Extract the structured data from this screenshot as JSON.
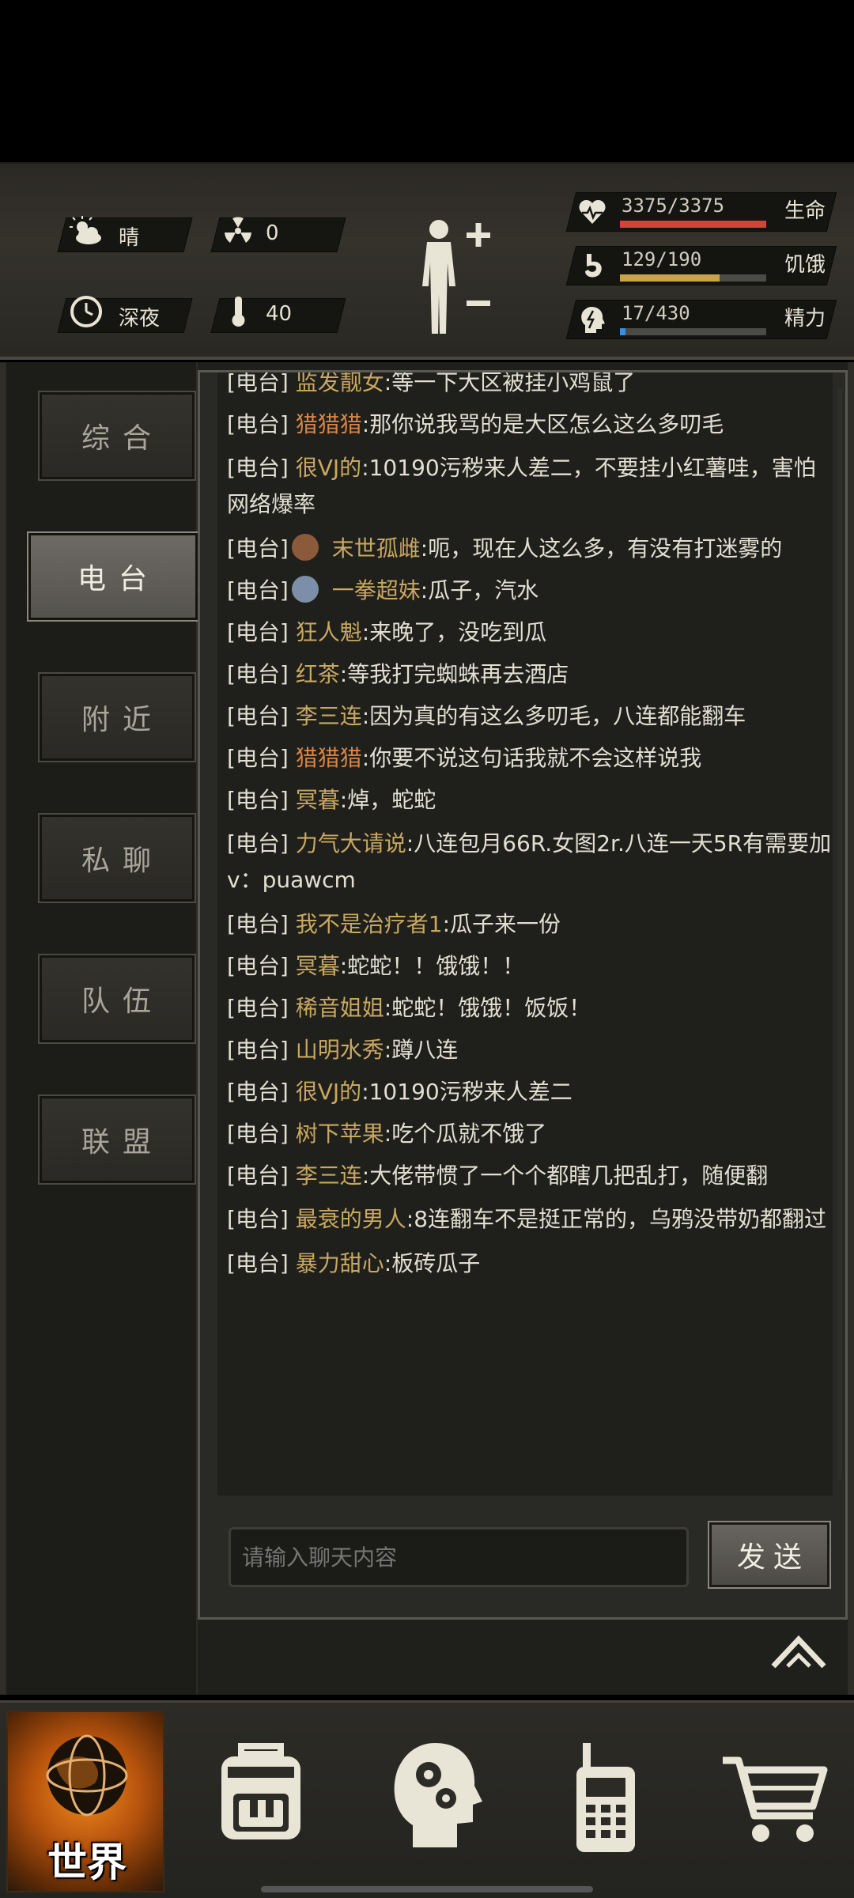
{
  "hud": {
    "weather": {
      "icon": "cloud-sun-icon",
      "label": "晴"
    },
    "radiation": {
      "icon": "radiation-icon",
      "value": "0"
    },
    "time": {
      "icon": "clock-icon",
      "label": "深夜"
    },
    "temperature": {
      "icon": "thermometer-icon",
      "value": "40"
    },
    "stats": [
      {
        "icon": "heart-pulse-icon",
        "text": "3375/3375",
        "label": "生命",
        "fill": 1.0,
        "color": "#d0443a"
      },
      {
        "icon": "stomach-icon",
        "text": "129/190",
        "label": "饥饿",
        "fill": 0.679,
        "color": "#c9a24a"
      },
      {
        "icon": "head-bolt-icon",
        "text": "17/430",
        "label": "精力",
        "fill": 0.04,
        "color": "#3b8ed8"
      }
    ]
  },
  "tabs": [
    {
      "label": "综合",
      "active": false
    },
    {
      "label": "电台",
      "active": true
    },
    {
      "label": "附近",
      "active": false
    },
    {
      "label": "私聊",
      "active": false
    },
    {
      "label": "队伍",
      "active": false
    },
    {
      "label": "联盟",
      "active": false
    }
  ],
  "chat": {
    "channel_tag": "[电台]",
    "messages": [
      {
        "name": "监发靓女",
        "text": ":等一下大区被挂小鸡鼠了",
        "style": "yellow"
      },
      {
        "name": "猎猎猎",
        "text": ":那你说我骂的是大区怎么这么多叨毛",
        "style": "orange"
      },
      {
        "name": "很VJ的",
        "text": ":10190污秽来人差二，不要挂小红薯哇，害怕网络爆率",
        "style": "yellow"
      },
      {
        "name": "末世孤雌",
        "text": ":呃，现在人这么多，有没有打迷雾的",
        "style": "yellow",
        "avatar": "#8a5a3a"
      },
      {
        "name": "一拳超妹",
        "text": ":瓜子，汽水",
        "style": "yellow",
        "avatar": "#7d8fa8"
      },
      {
        "name": "狂人魁",
        "text": ":来晚了，没吃到瓜",
        "style": "yellow"
      },
      {
        "name": "红茶",
        "text": ":等我打完蜘蛛再去酒店",
        "style": "yellow"
      },
      {
        "name": "李三连",
        "text": ":因为真的有这么多叨毛，八连都能翻车",
        "style": "yellow"
      },
      {
        "name": "猎猎猎",
        "text": ":你要不说这句话我就不会这样说我",
        "style": "orange"
      },
      {
        "name": "冥暮",
        "text": ":焯，蛇蛇",
        "style": "yellow"
      },
      {
        "name": "力气大请说",
        "text": ":八连包月66R.女图2r.八连一天5R有需要加v：puawcm",
        "style": "yellow"
      },
      {
        "name": "我不是治疗者1",
        "text": ":瓜子来一份",
        "style": "yellow"
      },
      {
        "name": "冥暮",
        "text": ":蛇蛇！！饿饿！！",
        "style": "yellow"
      },
      {
        "name": "稀音姐姐",
        "text": ":蛇蛇！饿饿！饭饭！",
        "style": "yellow"
      },
      {
        "name": "山明水秀",
        "text": ":蹲八连",
        "style": "yellow"
      },
      {
        "name": "很VJ的",
        "text": ":10190污秽来人差二",
        "style": "yellow"
      },
      {
        "name": "树下苹果",
        "text": ":吃个瓜就不饿了",
        "style": "yellow"
      },
      {
        "name": "李三连",
        "text": ":大佬带惯了一个个都瞎几把乱打，随便翻",
        "style": "yellow"
      },
      {
        "name": "最衰的男人",
        "text": ":8连翻车不是挺正常的，乌鸦没带奶都翻过",
        "style": "yellow"
      },
      {
        "name": "暴力甜心",
        "text": ":板砖瓜子",
        "style": "yellow"
      }
    ],
    "input_placeholder": "请输入聊天内容",
    "send_label": "发送"
  },
  "bottom_nav": [
    {
      "id": "world",
      "label": "世界",
      "icon": "globe-icon",
      "active": true
    },
    {
      "id": "backpack",
      "icon": "backpack-icon"
    },
    {
      "id": "skills",
      "icon": "head-gears-icon"
    },
    {
      "id": "radio",
      "icon": "walkie-talkie-icon"
    },
    {
      "id": "shop",
      "icon": "shopping-cart-icon"
    }
  ]
}
